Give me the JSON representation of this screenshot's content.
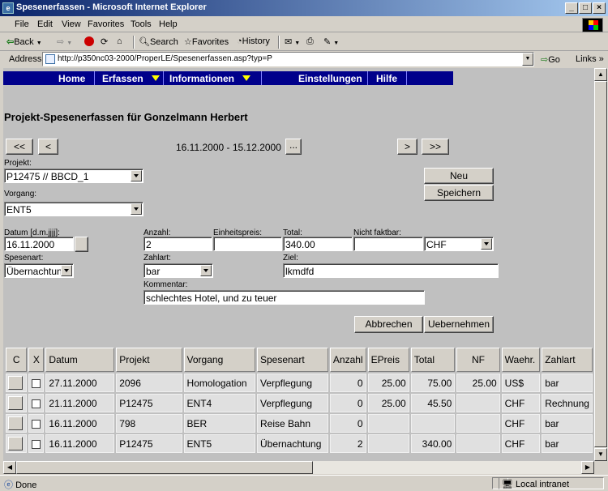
{
  "window": {
    "title": "Spesenerfassen - Microsoft Internet Explorer",
    "controls": [
      "_",
      "□",
      "×"
    ]
  },
  "menu": [
    "File",
    "Edit",
    "View",
    "Favorites",
    "Tools",
    "Help"
  ],
  "toolbar": {
    "back": "Back",
    "search": "Search",
    "favorites": "Favorites",
    "history": "History"
  },
  "address": {
    "label": "Address",
    "url": "http://p350nc03-2000/ProperLE/Spesenerfassen.asp?typ=P",
    "go": "Go",
    "links": "Links"
  },
  "status": {
    "text": "Done",
    "zone": "Local intranet"
  },
  "nav": {
    "home": "Home",
    "erfassen": "Erfassen",
    "informationen": "Informationen",
    "einstellungen": "Einstellungen",
    "hilfe": "Hilfe"
  },
  "page": {
    "title": "Projekt-Spesenerfassen für Gonzelmann Herbert",
    "first": "<<",
    "prev": "<",
    "next": ">",
    "last": ">>",
    "range": "16.11.2000  -  15.12.2000",
    "range_picker": "..."
  },
  "form": {
    "projekt_label": "Projekt:",
    "projekt_value": "P12475 // BBCD_1",
    "vorgang_label": "Vorgang:",
    "vorgang_value": "ENT5",
    "datum_label": "Datum [d.m.jjjj]:",
    "datum_value": "16.11.2000",
    "anzahl_label": "Anzahl:",
    "anzahl_value": "2",
    "einheitspreis_label": "Einheitspreis:",
    "einheitspreis_value": "",
    "total_label": "Total:",
    "total_value": "340.00",
    "nichtfakt_label": "Nicht faktbar:",
    "nichtfakt_value": "",
    "waehrung_value": "CHF",
    "spesenart_label": "Spesenart:",
    "spesenart_value": "Übernachtun",
    "zahlart_label": "Zahlart:",
    "zahlart_value": "bar",
    "ziel_label": "Ziel:",
    "ziel_value": "lkmdfd",
    "kommentar_label": "Kommentar:",
    "kommentar_value": "schlechtes Hotel, und zu teuer",
    "neu": "Neu",
    "speichern": "Speichern",
    "abbrechen": "Abbrechen",
    "uebernehmen": "Uebernehmen"
  },
  "table": {
    "headers": [
      "C",
      "X",
      "Datum",
      "Projekt",
      "Vorgang",
      "Spesenart",
      "Anzahl",
      "EPreis",
      "Total",
      "NF",
      "Waehr.",
      "Zahlart"
    ],
    "rows": [
      [
        "27.11.2000",
        "2096",
        "Homologation",
        "Verpflegung",
        "0",
        "25.00",
        "75.00",
        "25.00",
        "US$",
        "bar"
      ],
      [
        "21.11.2000",
        "P12475",
        "ENT4",
        "Verpflegung",
        "0",
        "25.00",
        "45.50",
        "",
        "CHF",
        "Rechnung"
      ],
      [
        "16.11.2000",
        "798",
        "BER",
        "Reise Bahn",
        "0",
        "",
        "",
        "",
        "CHF",
        "bar"
      ],
      [
        "16.11.2000",
        "P12475",
        "ENT5",
        "Übernachtung",
        "2",
        "",
        "340.00",
        "",
        "CHF",
        "bar"
      ]
    ]
  }
}
